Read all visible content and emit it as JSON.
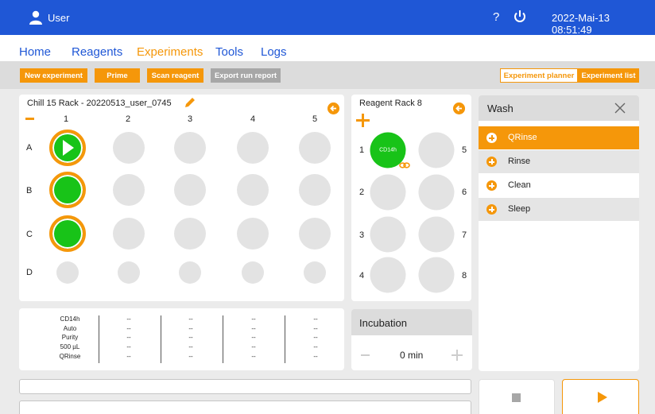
{
  "topbar": {
    "user": "User",
    "help": "?",
    "datetime": "2022-Mai-13 08:51:49"
  },
  "nav": [
    "Home",
    "Reagents",
    "Experiments",
    "Tools",
    "Logs"
  ],
  "toolbar": {
    "new_experiment": "New experiment",
    "prime": "Prime",
    "scan_reagent": "Scan reagent",
    "export_run_report": "Export run report",
    "experiment_planner": "Experiment planner",
    "experiment_list": "Experiment list"
  },
  "sample_rack": {
    "title": "Chill 15 Rack - 20220513_user_0745",
    "columns": [
      "1",
      "2",
      "3",
      "4",
      "5"
    ],
    "rows": [
      "A",
      "B",
      "C",
      "D"
    ]
  },
  "reagent_rack": {
    "title": "Reagent Rack 8",
    "positions": [
      "1",
      "2",
      "3",
      "4",
      "5",
      "6",
      "7",
      "8"
    ],
    "reagent_label": "CD14h"
  },
  "wash": {
    "title": "Wash",
    "items": [
      "QRinse",
      "Rinse",
      "Clean",
      "Sleep"
    ]
  },
  "summary": {
    "labels": [
      "CD14h",
      "Auto",
      "Purity",
      "500 µL",
      "QRinse"
    ],
    "placeholder": "--"
  },
  "incubation": {
    "title": "Incubation",
    "value": "0 min"
  },
  "colors": {
    "accent": "#f5970a",
    "brand_blue": "#1f57d6",
    "well_green": "#18c318"
  }
}
